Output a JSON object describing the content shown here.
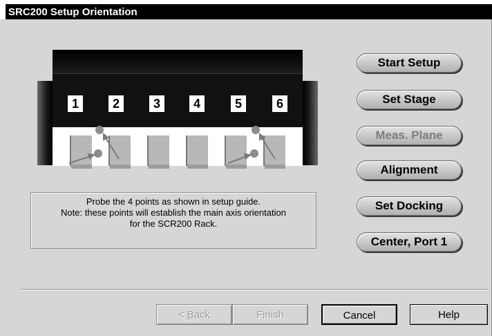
{
  "window": {
    "title": "SRC200 Setup Orientation"
  },
  "rack": {
    "slots": [
      "1",
      "2",
      "3",
      "4",
      "5",
      "6"
    ]
  },
  "side_buttons": [
    {
      "label": "Start Setup",
      "enabled": true
    },
    {
      "label": "Set Stage",
      "enabled": true
    },
    {
      "label": "Meas. Plane",
      "enabled": false
    },
    {
      "label": "Alignment",
      "enabled": true
    },
    {
      "label": "Set Docking",
      "enabled": true
    },
    {
      "label": "Center, Port 1",
      "enabled": true
    }
  ],
  "info": {
    "line1": "Probe the 4 points as shown in setup guide.",
    "line2": "Note: these points will establish the main axis orientation",
    "line3": "for the SCR200 Rack."
  },
  "footer": {
    "back_prefix": "< ",
    "back_accel": "B",
    "back_rest": "ack",
    "finish": "Finish",
    "cancel": "Cancel",
    "help": "Help"
  },
  "colors": {
    "titlebar": "#000000",
    "dialog_bg": "#d6d6d6"
  }
}
